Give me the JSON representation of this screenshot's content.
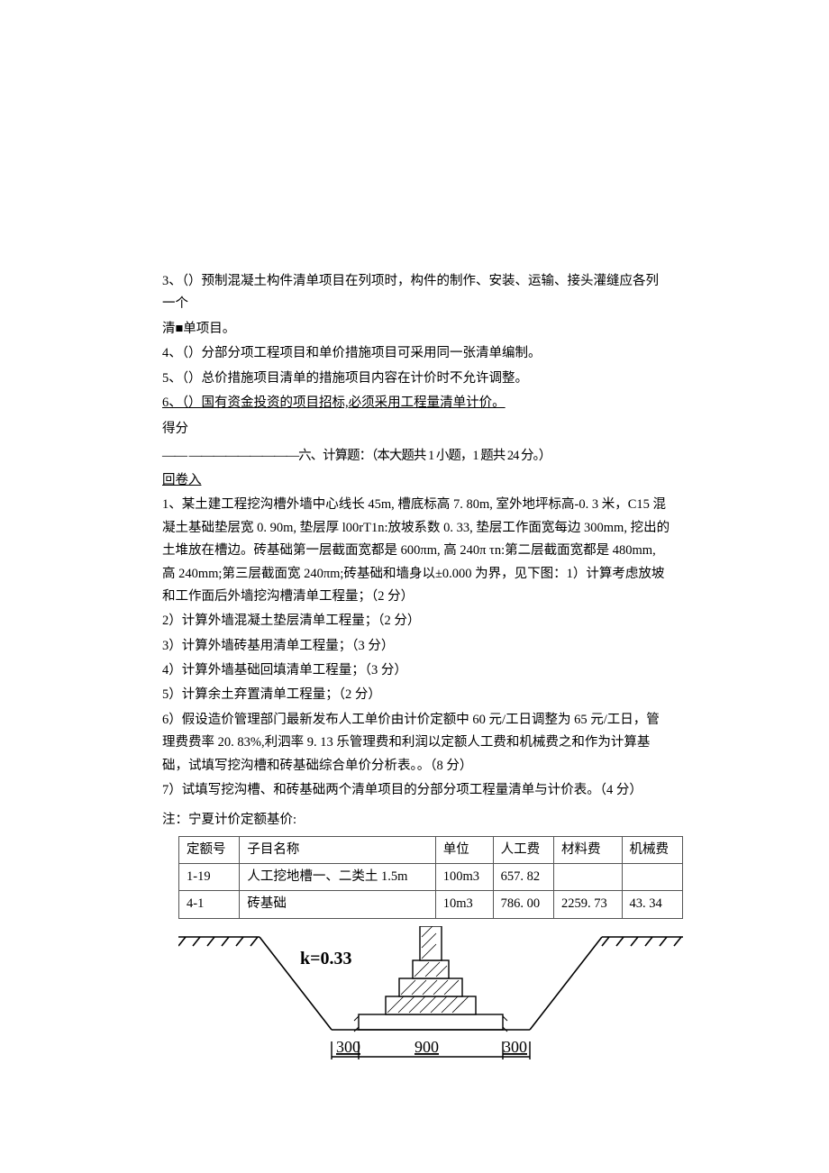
{
  "questions": {
    "q3": "3、（）预制混凝土构件清单项目在列项时，构件的制作、安装、运输、接头灌缝应各列一个",
    "q3b": "清■单项目。",
    "q4": "4、（）分部分项工程项目和单价措施项目可采用同一张清单编制。",
    "q5": "5、（）总价措施项目清单的措施项目内容在计价时不允许调整。",
    "q6": "6、（）国有资金投资的项目招标,必须采用工程量清单计价。"
  },
  "score": "得分",
  "section6": {
    "dashes": "—— —————————六、计算题：（本大题共 1 小题，1 题共 24 分。）",
    "returner": "回卷入"
  },
  "calc": {
    "p1": "1、某土建工程挖沟槽外墙中心线长 45m, 槽底标高 7. 80m, 室外地坪标高-0. 3 米，C15 混凝土基础垫层宽 0. 90m, 垫层厚 l00rT1n:放坡系数 0. 33, 垫层工作面宽每边 300mm, 挖出的土堆放在槽边。砖基础第一层截面宽都是 600πm, 高 240π τn:第二层截面宽都是 480mm, 高 240mm;第三层截面宽 240πm;砖基础和墙身以±0.000 为界，见下图：1）计算考虑放坡和工作面后外墙挖沟槽清单工程量；（2 分）",
    "p2": "2）计算外墙混凝土垫层清单工程量；（2 分）",
    "p3": "3）计算外墙砖基用清单工程量；（3 分）",
    "p4": "4）计算外墙基础回填清单工程量；（3 分）",
    "p5": "5）计算余土弃置清单工程量；（2 分）",
    "p6": "6）假设造价管理部门最新发布人工单价由计价定额中 60 元/工日调整为 65 元/工日，管理费费率 20. 83%,利泗率 9. 13 乐管理费和利润以定额人工费和机械费之和作为计算基础，试填写挖沟槽和砖基础综合单价分析表。。（8 分）",
    "p7": "7）试填写挖沟槽、和砖基础两个清单项目的分部分项工程量清单与计价表。（4 分）"
  },
  "note": "注：宁夏计价定额基价:",
  "table": {
    "headers": [
      "定额号",
      "子目名称",
      "单位",
      "人工费",
      "材料费",
      "机械费"
    ],
    "rows": [
      [
        "1-19",
        "人工挖地槽一、二类土 1.5m",
        "100m3",
        "657. 82",
        "",
        ""
      ],
      [
        "4-1",
        "砖基础",
        "10m3",
        "786. 00",
        "2259. 73",
        "43. 34"
      ]
    ]
  },
  "diagram": {
    "k_label": "k=0.33",
    "dims": [
      "300",
      "900",
      "300"
    ]
  }
}
